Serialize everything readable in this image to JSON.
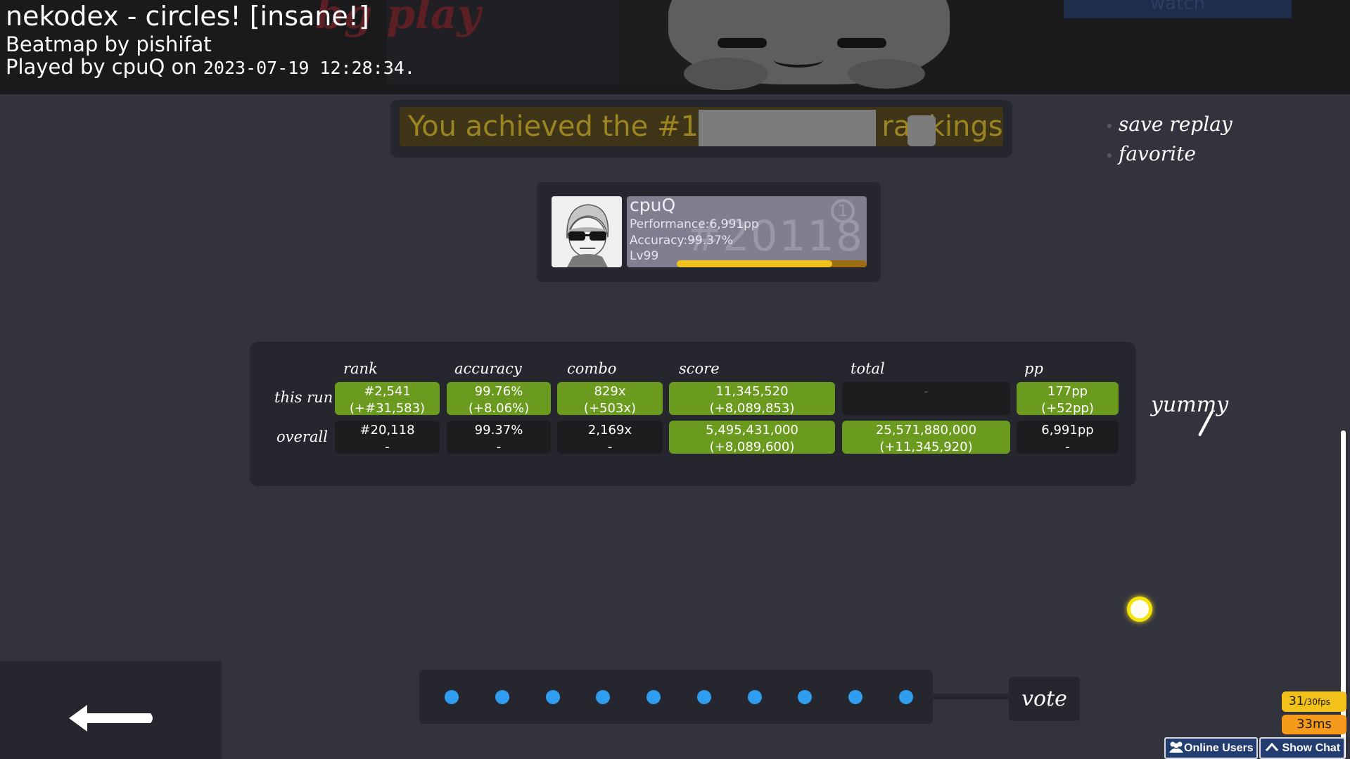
{
  "header": {
    "title": "nekodex - circles! [insane!]",
    "mapper": "Beatmap by pishifat",
    "played_prefix": "Played by cpuQ on",
    "played_datetime": "2023-07-19 12:28:34."
  },
  "background_art": {
    "red_text": "bg play",
    "corner_text": "watch"
  },
  "achievement": {
    "text": "You achieved the #1 score in the rankings!"
  },
  "side_menu": {
    "save_replay": "save replay",
    "favorite": "favorite"
  },
  "user_card": {
    "username": "cpuQ",
    "performance": "Performance:6,991pp",
    "accuracy": "Accuracy:99.37%",
    "level": "Lv99",
    "rank_watermark": "#20118",
    "rank_badge": "1",
    "level_progress": 0.82
  },
  "stats": {
    "columns": [
      "rank",
      "accuracy",
      "combo",
      "score",
      "total",
      "pp"
    ],
    "rows": [
      {
        "label": "this run",
        "cells": [
          {
            "line1": "#2,541",
            "line2": "(+#31,583)"
          },
          {
            "line1": "99.76%",
            "line2": "(+8.06%)"
          },
          {
            "line1": "829x",
            "line2": "(+503x)"
          },
          {
            "line1": "11,345,520",
            "line2": "(+8,089,853)"
          },
          {
            "line1": "-",
            "line2": ""
          },
          {
            "line1": "177pp",
            "line2": "(+52pp)"
          }
        ]
      },
      {
        "label": "overall",
        "cells": [
          {
            "line1": "#20,118",
            "line2": "-"
          },
          {
            "line1": "99.37%",
            "line2": "-"
          },
          {
            "line1": "2,169x",
            "line2": "-"
          },
          {
            "line1": "5,495,431,000",
            "line2": "(+8,089,600)"
          },
          {
            "line1": "25,571,880,000",
            "line2": "(+11,345,920)"
          },
          {
            "line1": "6,991pp",
            "line2": "-"
          }
        ]
      }
    ],
    "annotation": "yummy"
  },
  "vote": {
    "label": "vote",
    "dot_color": "#2f9ef0",
    "dot_count": 10
  },
  "overlay": {
    "fps": "31",
    "fps_target": "/30fps",
    "latency": "33ms",
    "online_users": "Online Users",
    "show_chat": "Show Chat"
  },
  "colors": {
    "improved_cell": "#6a9a1e",
    "neutral_cell": "#1d1d1f",
    "level_bar": "#f1c21d",
    "cursor": "#f5e30d"
  }
}
